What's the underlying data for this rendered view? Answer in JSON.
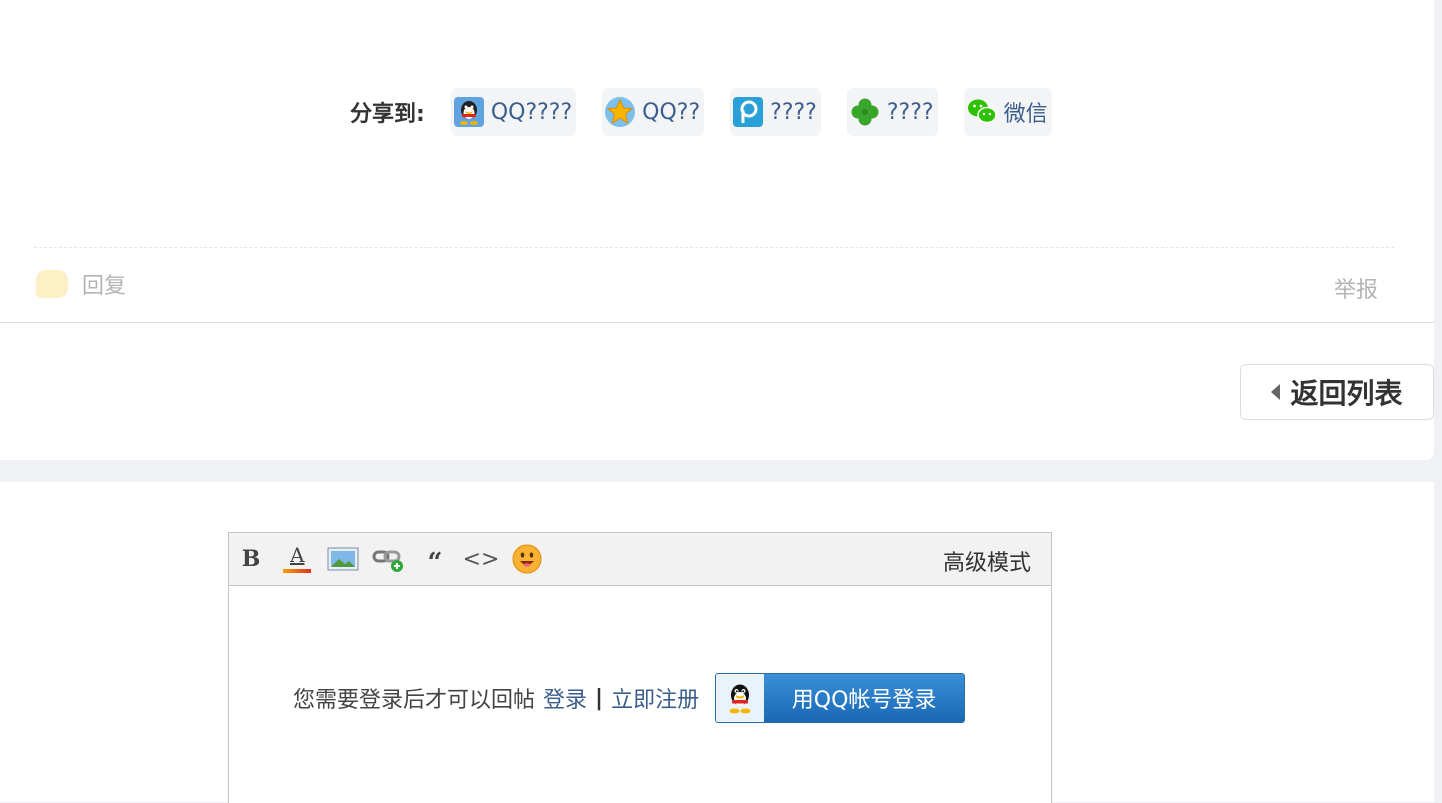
{
  "share": {
    "label": "分享到:",
    "items": [
      {
        "label": "QQ????",
        "icon": "qq-penguin-icon"
      },
      {
        "label": "QQ??",
        "icon": "qzone-star-icon"
      },
      {
        "label": "????",
        "icon": "tencent-weibo-icon"
      },
      {
        "label": "????",
        "icon": "clover-icon"
      },
      {
        "label": "微信",
        "icon": "wechat-icon"
      }
    ]
  },
  "post_actions": {
    "reply": "回复",
    "report": "举报"
  },
  "nav": {
    "back_to_list": "返回列表"
  },
  "editor": {
    "toolbar": {
      "bold": "B",
      "font_color": "A",
      "advanced_mode": "高级模式"
    },
    "login_prompt": "您需要登录后才可以回帖",
    "login_link": "登录",
    "separator": "|",
    "register_link": "立即注册",
    "qq_login": "用QQ帐号登录"
  },
  "colors": {
    "link": "#3b5e8c",
    "muted": "#b4b4b4",
    "qq_blue": "#1a68b5"
  }
}
